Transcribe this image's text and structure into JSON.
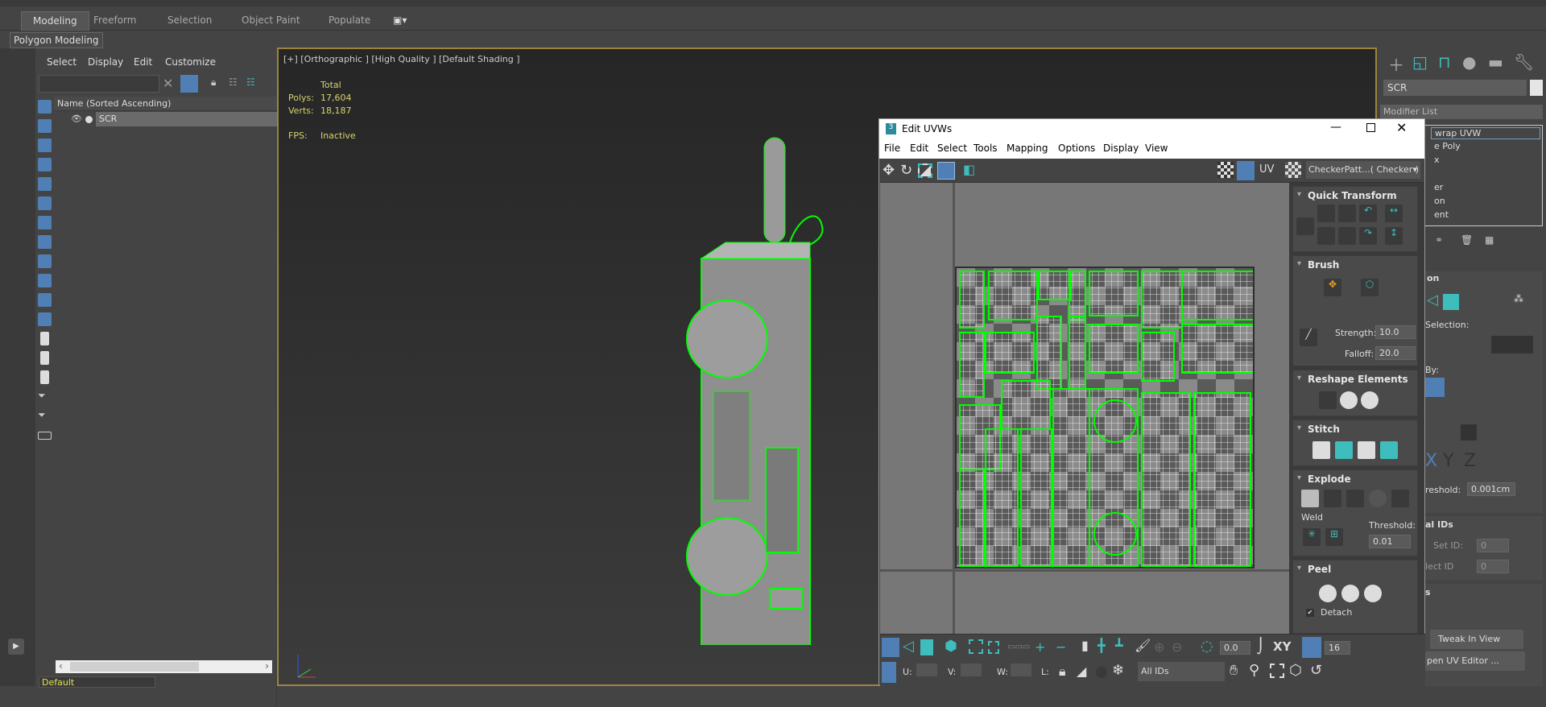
{
  "ribbon": {
    "tabs": [
      "Modeling",
      "Freeform",
      "Selection",
      "Object Paint",
      "Populate"
    ],
    "active": "Modeling",
    "sub": "Polygon Modeling"
  },
  "explorer": {
    "menu": [
      "Select",
      "Display",
      "Edit",
      "Customize"
    ],
    "header": "Name (Sorted Ascending)",
    "rows": [
      "SCR"
    ],
    "layer": "Default"
  },
  "viewport": {
    "label": "[+] [Orthographic ] [High Quality ] [Default Shading ]",
    "stats": {
      "total": "Total",
      "polys_label": "Polys:",
      "polys": "17,604",
      "verts_label": "Verts:",
      "verts": "18,187",
      "fps_label": "FPS:",
      "fps": "Inactive"
    }
  },
  "uv": {
    "title": "Edit UVWs",
    "menu": [
      "File",
      "Edit",
      "Select",
      "Tools",
      "Mapping",
      "Options",
      "Display",
      "View"
    ],
    "uv_label": "UV",
    "texture": "CheckerPatt...( Checker )",
    "rollouts": {
      "quick": "Quick Transform",
      "brush": "Brush",
      "strength_label": "Strength:",
      "strength": "10.0",
      "falloff_label": "Falloff:",
      "falloff": "20.0",
      "reshape": "Reshape Elements",
      "stitch": "Stitch",
      "explode": "Explode",
      "weld": "Weld",
      "threshold_label": "Threshold:",
      "threshold": "0.01",
      "peel": "Peel",
      "detach": "Detach"
    },
    "bottom": {
      "angle": "0.0",
      "xy": "XY",
      "snap": "16",
      "u": "U:",
      "v": "V:",
      "w": "W:",
      "l": "L:",
      "ids": "All IDs"
    }
  },
  "command": {
    "object": "SCR",
    "modifier_list": "Modifier List",
    "stack": [
      "wrap UVW",
      "e Poly",
      "x",
      "",
      "er",
      "on",
      "ent"
    ],
    "partial": {
      "sel": "on",
      "selection": "Selection:",
      "by": "By:",
      "xyz": [
        "X",
        "Y",
        "Z"
      ],
      "threshold": "reshold:",
      "threshold_val": "0.001cm",
      "ids": "al IDs",
      "setid": "Set ID:",
      "setid_val": "0",
      "selid": "lect ID",
      "selid_val": "0",
      "s": "s",
      "open": "pen UV Editor ...",
      "tweak": "Tweak In View"
    }
  },
  "colors": {
    "accent": "#4f7fb5",
    "teal": "#3fbcbc",
    "wire": "#00ff00",
    "stats": "#d8d36a"
  }
}
